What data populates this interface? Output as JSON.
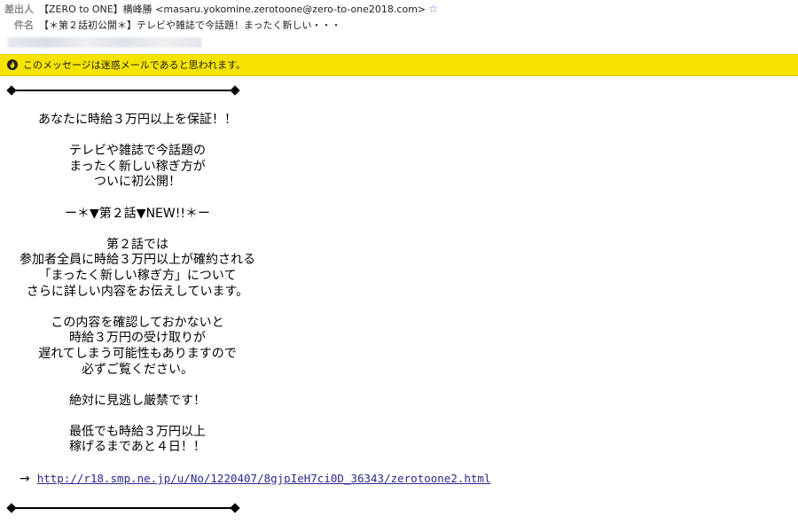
{
  "header": {
    "from_label": "差出人",
    "from_value": "【ZERO to ONE】横峰勝 <masaru.yokomine.zerotoone@zero-to-one2018.com>",
    "subject_label": "件名",
    "subject_value": "【＊第２話初公開＊】テレビや雑誌で今話題！まったく新しい・・・",
    "star_icon": "star-icon"
  },
  "junk_banner": {
    "text": "このメッセージは迷惑メールであると思われます。",
    "icon": "flame-icon",
    "color": "#f6e400"
  },
  "body": {
    "lines": [
      "あなたに時給３万円以上を保証！！",
      "",
      "テレビや雑誌で今話題の",
      "まったく新しい稼ぎ方が",
      "ついに初公開！",
      "",
      "ー＊▼第２話▼NEW!!＊ー",
      "",
      "第２話では",
      "参加者全員に時給３万円以上が確約される",
      "「まったく新しい稼ぎ方」について",
      "さらに詳しい内容をお伝えしています。",
      "",
      "この内容を確認しておかないと",
      "時給３万円の受け取りが",
      "遅れてしまう可能性もありますので",
      "必ずご覧ください。",
      "",
      "絶対に見逃し厳禁です！",
      "",
      "最低でも時給３万円以上",
      "稼げるまであと４日！！"
    ],
    "link_arrow": "→",
    "link_url": "http://r18.smp.ne.jp/u/No/1220407/8gjpIeH7ci0D_36343/zerotoone2.html"
  }
}
